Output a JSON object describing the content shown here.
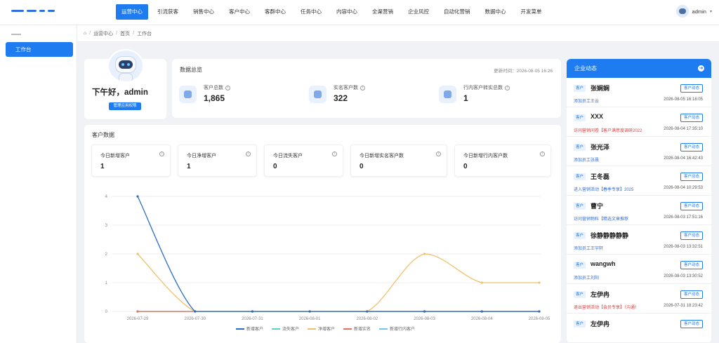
{
  "nav": {
    "items": [
      "运营中心",
      "引流获客",
      "销售中心",
      "客户中心",
      "客群中心",
      "任务中心",
      "内容中心",
      "全渠营销",
      "企业风控",
      "自动化营销",
      "数据中心",
      "开发菜单"
    ],
    "active_index": 0
  },
  "user": {
    "name": "admin"
  },
  "sidebar": {
    "item": "工作台"
  },
  "breadcrumb": [
    "运营中心",
    "首页",
    "工作台"
  ],
  "profile": {
    "greeting": "下午好，admin",
    "button": "管理应用权限"
  },
  "overview": {
    "title": "数据总览",
    "update_time": "更新时间：2026-08-05 16:26",
    "stats": [
      {
        "label": "客户总数",
        "value": "1,865"
      },
      {
        "label": "实名客户数",
        "value": "322"
      },
      {
        "label": "行内客户转实总数",
        "value": "1"
      }
    ]
  },
  "customer": {
    "title": "客户数据",
    "cards": [
      {
        "label": "今日新增客户",
        "value": "1"
      },
      {
        "label": "今日净增客户",
        "value": "1"
      },
      {
        "label": "今日流失客户",
        "value": "0"
      },
      {
        "label": "今日新增实名客户数",
        "value": "0"
      },
      {
        "label": "今日新增行内客户数",
        "value": "0"
      }
    ]
  },
  "chart_data": {
    "type": "line",
    "x": [
      "2026-07-29",
      "2026-07-30",
      "2026-07-31",
      "2026-08-01",
      "2026-08-02",
      "2026-08-03",
      "2026-08-04",
      "2026-08-05"
    ],
    "ylim": [
      0,
      4
    ],
    "yticks": [
      0,
      1,
      2,
      3,
      4
    ],
    "grid": true,
    "legend_position": "bottom",
    "series": [
      {
        "name": "新增客户",
        "color": "#2b6cc4",
        "values": [
          4,
          0,
          0,
          0,
          0,
          0,
          0,
          0
        ]
      },
      {
        "name": "流失客户",
        "color": "#5ad3c0",
        "values": [
          0,
          0,
          0,
          0,
          0,
          0,
          0,
          0
        ]
      },
      {
        "name": "净增客户",
        "color": "#f0c16b",
        "values": [
          2,
          0,
          0,
          0,
          0,
          2,
          1,
          1
        ]
      },
      {
        "name": "新增实名",
        "color": "#e8705a",
        "values": [
          0,
          0,
          0,
          0,
          0,
          0,
          0,
          0
        ]
      },
      {
        "name": "新增行内客户",
        "color": "#6cc8ef",
        "values": [
          0,
          0,
          0,
          0,
          0,
          0,
          0,
          0
        ]
      }
    ]
  },
  "activity": {
    "title": "企业动态",
    "items": [
      {
        "tag": "客户",
        "name": "张娴娴",
        "button": "客户动态",
        "desc": "添加员工王云",
        "desc_color": "blue",
        "time": "2026-08-05 16:16:05"
      },
      {
        "tag": "客户",
        "name": "XXX",
        "button": "客户动态",
        "desc": "访问营销问卷【客户满意度调研2022",
        "desc_color": "red",
        "time": "2026-08-04 17:35:10"
      },
      {
        "tag": "客户",
        "name": "张光泽",
        "button": "客户动态",
        "desc": "添加员工张晨",
        "desc_color": "blue",
        "time": "2026-08-04 16:42:43"
      },
      {
        "tag": "客户",
        "name": "王冬磊",
        "button": "客户动态",
        "desc": "进入营销活动【春季专享】2025",
        "desc_color": "blue",
        "time": "2026-08-04 10:29:53"
      },
      {
        "tag": "客户",
        "name": "曹宁",
        "button": "客户动态",
        "desc": "访问营销物料【精选文章推荐",
        "desc_color": "blue",
        "time": "2026-08-03 17:51:16"
      },
      {
        "tag": "客户",
        "name": "徐静静静静静",
        "button": "客户动态",
        "desc": "添加员工王宇轩",
        "desc_color": "blue",
        "time": "2026-08-03 13:32:51"
      },
      {
        "tag": "客户",
        "name": "wangwh",
        "button": "客户动态",
        "desc": "添加员工刘阳",
        "desc_color": "blue",
        "time": "2026-08-03 13:30:52"
      },
      {
        "tag": "客户",
        "name": "左伊冉",
        "button": "客户动态",
        "desc": "退出营销活动【会员专享】（沟通）",
        "desc_color": "red",
        "time": "2026-07-31 18:23:42"
      },
      {
        "tag": "客户",
        "name": "左伊冉",
        "button": "客户动态",
        "desc": "",
        "desc_color": "blue",
        "time": ""
      }
    ]
  }
}
